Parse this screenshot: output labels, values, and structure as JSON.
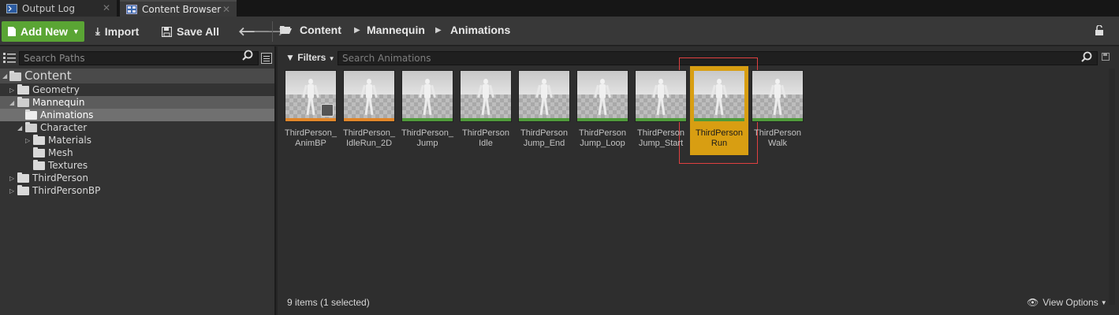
{
  "tabs": [
    {
      "label": "Output Log",
      "icon": "terminal-icon",
      "active": false
    },
    {
      "label": "Content Browser",
      "icon": "content-browser-icon",
      "active": true
    }
  ],
  "toolbar": {
    "add_new_label": "Add New",
    "import_label": "Import",
    "save_all_label": "Save All",
    "breadcrumb": [
      "Content",
      "Mannequin",
      "Animations"
    ],
    "accent_color": "#5aa534"
  },
  "left_panel": {
    "search_placeholder": "Search Paths",
    "tree": [
      {
        "label": "Content",
        "level": 0,
        "expanded": true
      },
      {
        "label": "Geometry",
        "level": 1,
        "expanded": false
      },
      {
        "label": "Mannequin",
        "level": 1,
        "expanded": true
      },
      {
        "label": "Animations",
        "level": 2,
        "selected": true
      },
      {
        "label": "Character",
        "level": 2,
        "expanded": true
      },
      {
        "label": "Materials",
        "level": 3,
        "expanded": false
      },
      {
        "label": "Mesh",
        "level": 3
      },
      {
        "label": "Textures",
        "level": 3
      },
      {
        "label": "ThirdPerson",
        "level": 1,
        "expanded": false
      },
      {
        "label": "ThirdPersonBP",
        "level": 1,
        "expanded": false
      }
    ]
  },
  "right_panel": {
    "filters_label": "Filters",
    "search_placeholder": "Search Animations",
    "assets": [
      {
        "line1": "ThirdPerson_",
        "line2": "AnimBP",
        "strip_color": "#e0862a",
        "selected": false
      },
      {
        "line1": "ThirdPerson_",
        "line2": "IdleRun_2D",
        "strip_color": "#e0862a",
        "selected": false
      },
      {
        "line1": "ThirdPerson_",
        "line2": "Jump",
        "strip_color": "#4f9a3a",
        "selected": false
      },
      {
        "line1": "ThirdPerson",
        "line2": "Idle",
        "strip_color": "#4f9a3a",
        "selected": false
      },
      {
        "line1": "ThirdPerson",
        "line2": "Jump_End",
        "strip_color": "#4f9a3a",
        "selected": false
      },
      {
        "line1": "ThirdPerson",
        "line2": "Jump_Loop",
        "strip_color": "#4f9a3a",
        "selected": false
      },
      {
        "line1": "ThirdPerson",
        "line2": "Jump_Start",
        "strip_color": "#4f9a3a",
        "selected": false
      },
      {
        "line1": "ThirdPerson",
        "line2": "Run",
        "strip_color": "#4f9a3a",
        "selected": true
      },
      {
        "line1": "ThirdPerson",
        "line2": "Walk",
        "strip_color": "#4f9a3a",
        "selected": false
      }
    ],
    "status_text": "9 items (1 selected)",
    "view_options_label": "View Options",
    "selection_color": "#d89e12"
  }
}
